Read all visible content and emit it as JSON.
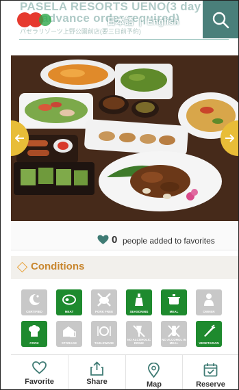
{
  "header": {
    "title_line1": "PASELA RESORTS UENO(3 day",
    "title_line2": "advance order required)",
    "title_sub": "パセラリゾーツ上野公園前店(要三日前予約)",
    "lang_japanese": "日本語",
    "lang_separator": "|",
    "lang_english": "English"
  },
  "favorites": {
    "count": "0",
    "text": "people added to favorites"
  },
  "conditions": {
    "title": "Conditions",
    "items": [
      {
        "label": "CERTIFIED",
        "state": "off",
        "icon": "moon-star-icon"
      },
      {
        "label": "MEAT",
        "state": "on",
        "icon": "meat-icon"
      },
      {
        "label": "PORK FREE",
        "state": "off",
        "icon": "pork-free-icon"
      },
      {
        "label": "SEASONING",
        "state": "on",
        "icon": "seasoning-icon"
      },
      {
        "label": "MEAL",
        "state": "on",
        "icon": "pot-icon"
      },
      {
        "label": "OWNER",
        "state": "off",
        "icon": "owner-icon"
      },
      {
        "label": "COOK",
        "state": "on",
        "icon": "chef-icon"
      },
      {
        "label": "STORAGE",
        "state": "off",
        "icon": "storage-icon"
      },
      {
        "label": "TABLEWARE",
        "state": "off",
        "icon": "tableware-icon"
      },
      {
        "label": "NO ALCOHOLIC DRINK",
        "state": "off",
        "icon": "no-drink-icon"
      },
      {
        "label": "NO ALCOHOL IN MEAL",
        "state": "off",
        "icon": "no-alcohol-meal-icon"
      },
      {
        "label": "VEGETARIAN",
        "state": "on",
        "icon": "vegetable-icon"
      }
    ]
  },
  "nav": {
    "favorite": "Favorite",
    "share": "Share",
    "map": "Map",
    "reserve": "Reserve"
  },
  "colors": {
    "teal": "#4a7f7a",
    "green": "#1e8a2e",
    "gold": "#e8bd38",
    "orange": "#c8862e"
  }
}
